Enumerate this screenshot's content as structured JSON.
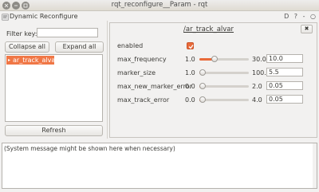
{
  "window": {
    "title": "rqt_reconfigure__Param - rqt"
  },
  "dock": {
    "title": "Dynamic Reconfigure",
    "buttons": "D ? - ○"
  },
  "left_pane": {
    "filter_label": "Filter key:",
    "filter_value": "",
    "collapse_label": "Collapse all",
    "expand_label": "Expand all",
    "tree_items": [
      "ar_track_alvar"
    ],
    "refresh_label": "Refresh"
  },
  "params": {
    "node_title": "/ar_track_alvar",
    "close_label": "✖",
    "enabled": {
      "label": "enabled",
      "checked": true
    },
    "rows": [
      {
        "name": "max_frequency",
        "min": "1.0",
        "max": "30.0",
        "value": "10.0",
        "level": 0.31
      },
      {
        "name": "marker_size",
        "min": "1.0",
        "max": "100.",
        "value": "5.5",
        "level": 0.045
      },
      {
        "name": "max_new_marker_error",
        "min": "0.0",
        "max": "2.0",
        "value": "0.05",
        "level": 0.025
      },
      {
        "name": "max_track_error",
        "min": "0.0",
        "max": "4.0",
        "value": "0.05",
        "level": 0.0125
      }
    ]
  },
  "status": {
    "message": "(System message might be shown here when necessary)"
  },
  "colors": {
    "accent": "#e96a39",
    "selection": "#f07746"
  }
}
